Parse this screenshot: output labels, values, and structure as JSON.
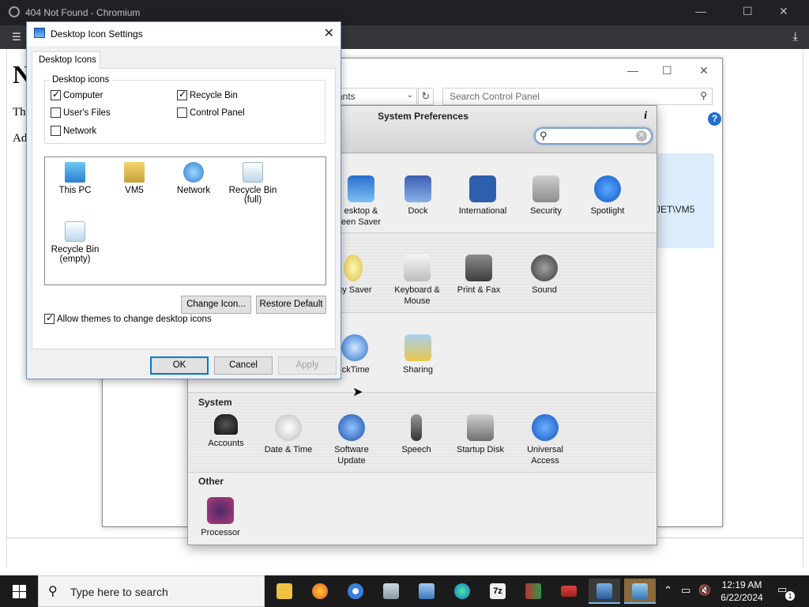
{
  "chrome": {
    "tab_title": "404 Not Found - Chromium",
    "page_heading": "N",
    "page_line1": "Th",
    "page_line2": "Ad"
  },
  "control_panel": {
    "address_text": "ants",
    "search_placeholder": "Search Control Panel",
    "highlight_text": "JET\\VM5"
  },
  "system_preferences": {
    "title": "System Preferences",
    "info_label": "i",
    "rows": [
      {
        "section": "",
        "items": [
          "Desktop &\nScreen Saver",
          "Dock",
          "International",
          "Security",
          "Spotlight"
        ]
      },
      {
        "section": "",
        "items": [
          "Energy Saver",
          "Keyboard &\nMouse",
          "Print & Fax",
          "Sound"
        ]
      },
      {
        "section": "",
        "items": [
          "QuickTime",
          "Sharing"
        ]
      },
      {
        "section": "System",
        "items": [
          "Accounts",
          "Date & Time",
          "Software\nUpdate",
          "Speech",
          "Startup Disk",
          "Universal\nAccess"
        ]
      },
      {
        "section": "Other",
        "items": [
          "Processor"
        ]
      }
    ],
    "visible_labels": {
      "desktop": "esktop &",
      "desktop2": "een Saver",
      "dock": "Dock",
      "international": "International",
      "security": "Security",
      "spotlight": "Spotlight",
      "energy": "rgy Saver",
      "keyboard": "Keyboard &",
      "keyboard2": "Mouse",
      "print": "Print & Fax",
      "sound": "Sound",
      "quicktime": "ickTime",
      "sharing": "Sharing",
      "system_section": "System",
      "accounts": "Accounts",
      "datetime": "Date & Time",
      "software": "Software",
      "software2": "Update",
      "speech": "Speech",
      "startup": "Startup Disk",
      "universal": "Universal",
      "universal2": "Access",
      "other_section": "Other",
      "processor": "Processor"
    }
  },
  "desktop_icon_settings": {
    "title": "Desktop Icon Settings",
    "tab_label": "Desktop Icons",
    "group_label": "Desktop icons",
    "checkboxes": {
      "computer": {
        "label": "Computer",
        "checked": true
      },
      "recycle_bin": {
        "label": "Recycle Bin",
        "checked": true
      },
      "users_files": {
        "label": "User's Files",
        "checked": false
      },
      "control_panel": {
        "label": "Control Panel",
        "checked": false
      },
      "network": {
        "label": "Network",
        "checked": false
      }
    },
    "icons": {
      "this_pc": "This PC",
      "vm5": "VM5",
      "network": "Network",
      "recycle_full_1": "Recycle Bin",
      "recycle_full_2": "(full)",
      "recycle_empty_1": "Recycle Bin",
      "recycle_empty_2": "(empty)"
    },
    "change_icon_label": "Change Icon...",
    "restore_default_label": "Restore Default",
    "allow_themes_label": "Allow themes to change desktop icons",
    "allow_themes_checked": true,
    "ok_label": "OK",
    "cancel_label": "Cancel",
    "apply_label": "Apply"
  },
  "taskbar": {
    "search_placeholder": "Type here to search",
    "time": "12:19 AM",
    "date": "6/22/2024",
    "notification_count": "1",
    "apps": [
      "file-explorer-icon",
      "firefox-icon",
      "chromium-icon",
      "control-panel-icon",
      "network-app-icon",
      "edge-icon",
      "7zip-icon",
      "app-icon",
      "app-red-icon",
      "system-preferences-icon",
      "active-app-icon"
    ]
  },
  "colors": {
    "accent": "#0078d7",
    "taskbar": "#1b1b1b",
    "chrome_titlebar": "#202124"
  }
}
